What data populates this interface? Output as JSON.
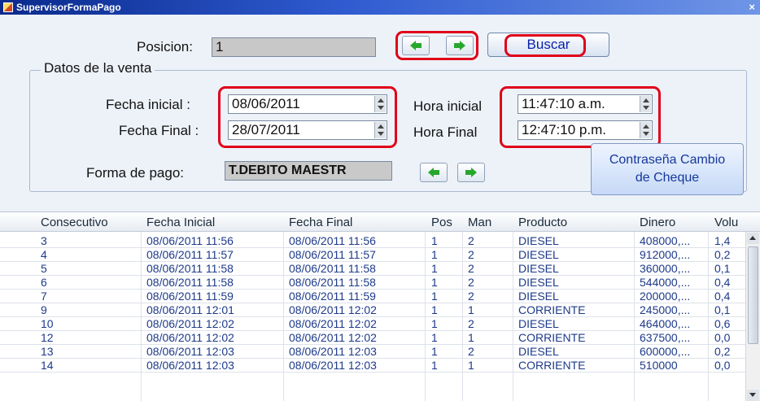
{
  "window": {
    "title": "SupervisorFormaPago",
    "close_glyph": "×"
  },
  "search": {
    "position_label": "Posicion:",
    "position_value": "1",
    "search_button": "Buscar"
  },
  "sale_data": {
    "group_title": "Datos de la venta",
    "start_date_label": "Fecha inicial :",
    "start_date_value": "08/06/2011",
    "end_date_label": "Fecha Final :",
    "end_date_value": "28/07/2011",
    "start_time_label": "Hora inicial",
    "start_time_value": "11:47:10 a.m.",
    "end_time_label": "Hora Final",
    "end_time_value": "12:47:10 p.m.",
    "payment_label": "Forma de pago:",
    "payment_value": "T.DEBITO MAESTR"
  },
  "password_button": {
    "line1": "Contraseña Cambio",
    "line2": "de Cheque"
  },
  "table": {
    "columns": [
      "Consecutivo",
      "Fecha Inicial",
      "Fecha Final",
      "Pos",
      "Man",
      "Producto",
      "Dinero",
      "Volu"
    ],
    "rows": [
      [
        "3",
        "08/06/2011 11:56",
        "08/06/2011 11:56",
        "1",
        "2",
        "DIESEL",
        "408000,...",
        "1,4"
      ],
      [
        "4",
        "08/06/2011 11:57",
        "08/06/2011 11:57",
        "1",
        "2",
        "DIESEL",
        "912000,...",
        "0,2"
      ],
      [
        "5",
        "08/06/2011 11:58",
        "08/06/2011 11:58",
        "1",
        "2",
        "DIESEL",
        "360000,...",
        "0,1"
      ],
      [
        "6",
        "08/06/2011 11:58",
        "08/06/2011 11:58",
        "1",
        "2",
        "DIESEL",
        "544000,...",
        "0,4"
      ],
      [
        "7",
        "08/06/2011 11:59",
        "08/06/2011 11:59",
        "1",
        "2",
        "DIESEL",
        "200000,...",
        "0,4"
      ],
      [
        "9",
        "08/06/2011 12:01",
        "08/06/2011 12:02",
        "1",
        "1",
        "CORRIENTE",
        "245000,...",
        "0,1"
      ],
      [
        "10",
        "08/06/2011 12:02",
        "08/06/2011 12:02",
        "1",
        "2",
        "DIESEL",
        "464000,...",
        "0,6"
      ],
      [
        "12",
        "08/06/2011 12:02",
        "08/06/2011 12:02",
        "1",
        "1",
        "CORRIENTE",
        "637500,...",
        "0,0"
      ],
      [
        "13",
        "08/06/2011 12:03",
        "08/06/2011 12:03",
        "1",
        "2",
        "DIESEL",
        "600000,...",
        "0,2"
      ],
      [
        "14",
        "08/06/2011 12:03",
        "08/06/2011 12:03",
        "1",
        "1",
        "CORRIENTE",
        "510000",
        "0,0"
      ]
    ]
  },
  "colors": {
    "highlight": "#e0001a",
    "accent_text": "#0a1fa8",
    "arrow_green": "#27a82c",
    "panel_bg": "#edf2f8"
  },
  "icons": {
    "prev_position": "arrow-left-icon",
    "next_position": "arrow-right-icon",
    "prev_payment": "arrow-left-icon",
    "next_payment": "arrow-right-icon"
  }
}
